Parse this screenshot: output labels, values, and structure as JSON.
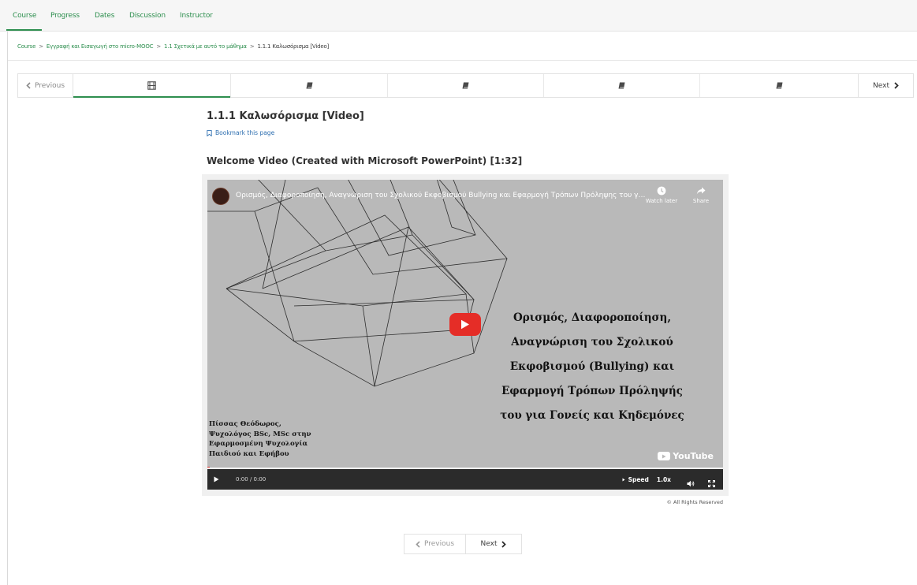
{
  "tabs": [
    {
      "label": "Course",
      "active": true
    },
    {
      "label": "Progress"
    },
    {
      "label": "Dates"
    },
    {
      "label": "Discussion"
    },
    {
      "label": "Instructor"
    }
  ],
  "breadcrumb": {
    "items": [
      "Course",
      "Εγγραφή και Εισαγωγή στο micro-MOOC",
      "1.1 Σχετικά με αυτό το μάθημα"
    ],
    "current": "1.1.1 Καλωσόρισμα [Video]",
    "separator": ">"
  },
  "sequence": {
    "prev_label": "Previous",
    "next_label": "Next",
    "units": [
      {
        "icon": "video-icon",
        "active": true
      },
      {
        "icon": "book-icon"
      },
      {
        "icon": "book-icon"
      },
      {
        "icon": "book-icon"
      },
      {
        "icon": "book-icon"
      },
      {
        "icon": "book-icon"
      }
    ]
  },
  "unit": {
    "title": "1.1.1 Καλωσόρισμα [Video]",
    "bookmark_label": "Bookmark this page",
    "video_heading": "Welcome Video (Created with Microsoft PowerPoint) [1:32]"
  },
  "video": {
    "title": "Ορισμός, Διαφοροποίηση, Αναγνώριση του Σχολικού Εκφοβισμού Bullying και Εφαρμογή Τρόπων Πρόληψης του για Γονείς και Κηδεμόνες",
    "watch_later_label": "Watch later",
    "share_label": "Share",
    "slide_lines": [
      "Ορισμός, Διαφοροποίηση,",
      "Αναγνώριση του Σχολικού",
      "Εκφοβισμού (Bullying) και",
      "Εφαρμογή Τρόπων Πρόληψής",
      "του για Γονείς και Κηδεμόνες"
    ],
    "author_lines": [
      "Πίσσας Θεόδωρος,",
      "Ψυχολόγος BSc, MSc στην",
      "Εφαρμοσμένη Ψυχολογία",
      "Παιδιού και Εφήβου"
    ],
    "youtube_label": "YouTube",
    "time": "0:00 / 0:00",
    "speed_label": "Speed",
    "speed_value": "1.0x",
    "play_color": "#e52d27"
  },
  "rights": "© All Rights Reserved",
  "bottom_nav": {
    "prev_label": "Previous",
    "next_label": "Next"
  },
  "colors": {
    "accent": "#2e8f4f",
    "link": "#2e6fb0"
  }
}
